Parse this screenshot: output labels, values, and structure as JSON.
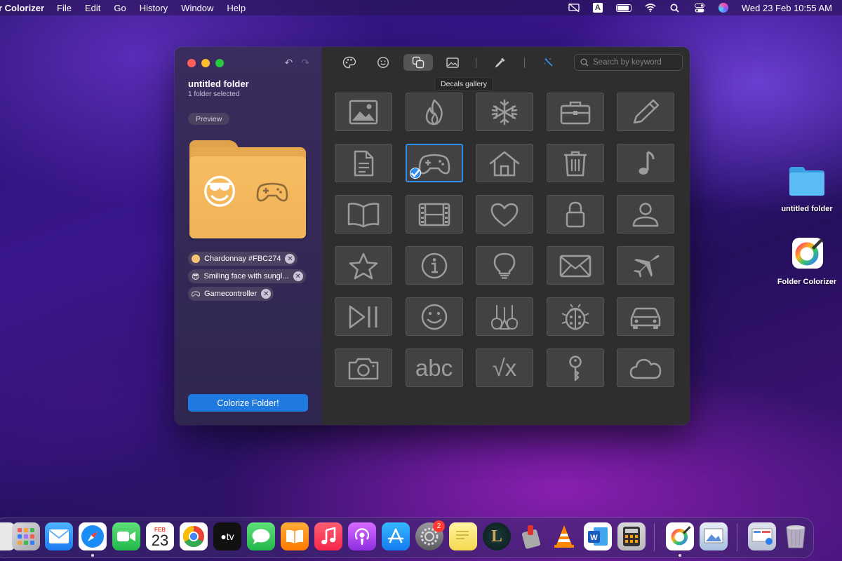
{
  "menubar": {
    "app_name": "r Colorizer",
    "menus": [
      "File",
      "Edit",
      "Go",
      "History",
      "Window",
      "Help"
    ],
    "keyboard_indicator": "A",
    "datetime": "Wed 23 Feb  10:55 AM"
  },
  "window": {
    "sidebar": {
      "folder_title": "untitled folder",
      "folder_subtitle": "1 folder selected",
      "preview_label": "Preview",
      "preview_emoji": "😎",
      "tags": [
        {
          "label": "Chardonnay #FBC274",
          "color": "#FBC274"
        },
        {
          "label": "Smiling face with sungl...",
          "emoji": "😎"
        },
        {
          "label": "Gamecontroller",
          "icon": "gamecontroller-icon"
        }
      ],
      "colorize_button": "Colorize Folder!"
    },
    "toolbar": {
      "tools": [
        "palette-icon",
        "smiley-icon",
        "decals-icon",
        "image-icon",
        "eyedropper-icon",
        "magic-wand-icon"
      ],
      "active_tool": "decals-icon",
      "search_placeholder": "Search by keyword",
      "tooltip": "Decals gallery"
    },
    "gallery": {
      "decals": [
        "image",
        "flame",
        "snowflake",
        "briefcase",
        "pencil",
        "document",
        "gamecontroller",
        "house",
        "trash",
        "music-note",
        "book",
        "film",
        "heart",
        "lock",
        "person",
        "star",
        "info",
        "lightbulb",
        "envelope",
        "airplane",
        "play-pause",
        "smiley",
        "guitars",
        "ladybug",
        "car",
        "camera",
        "abc",
        "square-root",
        "key",
        "cloud"
      ],
      "selected": "gamecontroller",
      "abc_text": "abc",
      "sqrt_text": "√x"
    }
  },
  "desktop": {
    "items": [
      {
        "label": "untitled folder"
      },
      {
        "label": "Folder Colorizer"
      }
    ]
  },
  "dock": {
    "calendar_month": "FEB",
    "calendar_day": "23",
    "tv_label": "tv",
    "settings_badge": "2"
  }
}
